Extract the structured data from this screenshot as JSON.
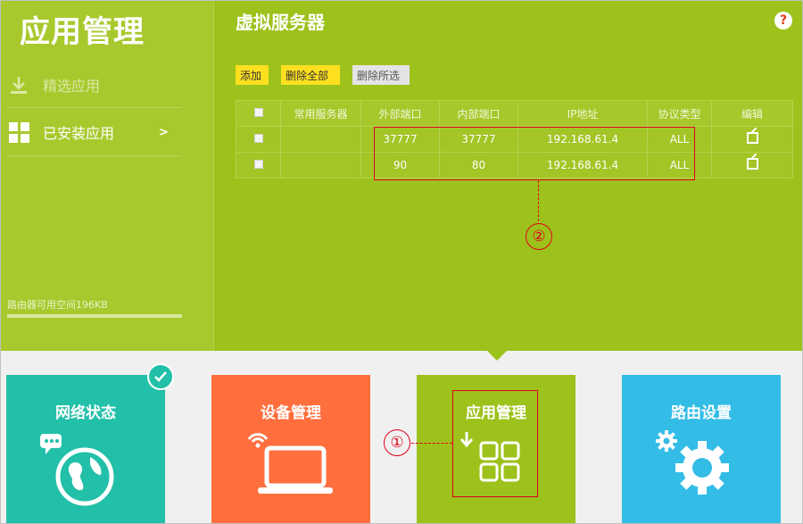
{
  "sidebar": {
    "title": "应用管理",
    "items": [
      {
        "label": "精选应用",
        "icon": "download-icon"
      },
      {
        "label": "已安装应用",
        "icon": "grid-icon",
        "arrow": ">"
      }
    ],
    "storage_text": "路由器可用空间196KB",
    "storage_used_fraction": 0.0
  },
  "main": {
    "heading": "虚拟服务器",
    "help": "?",
    "buttons": {
      "add": "添加",
      "delete_all": "删除全部",
      "delete_selected": "删除所选"
    },
    "table": {
      "headers": [
        "",
        "常用服务器",
        "外部端口",
        "内部端口",
        "IP地址",
        "协议类型",
        "编辑"
      ],
      "rows": [
        {
          "service": "",
          "external_port": "37777",
          "internal_port": "37777",
          "ip": "192.168.61.4",
          "protocol": "ALL"
        },
        {
          "service": "",
          "external_port": "90",
          "internal_port": "80",
          "ip": "192.168.61.4",
          "protocol": "ALL"
        }
      ]
    }
  },
  "annotations": {
    "marker1": "①",
    "marker2": "②"
  },
  "tiles": [
    {
      "label": "网络状态",
      "icon": "globe-chat-icon",
      "color": "#22c0a8"
    },
    {
      "label": "设备管理",
      "icon": "laptop-wifi-icon",
      "color": "#ff6f3d"
    },
    {
      "label": "应用管理",
      "icon": "apps-download-icon",
      "color": "#9dc21b"
    },
    {
      "label": "路由设置",
      "icon": "gears-icon",
      "color": "#33bde6"
    }
  ]
}
